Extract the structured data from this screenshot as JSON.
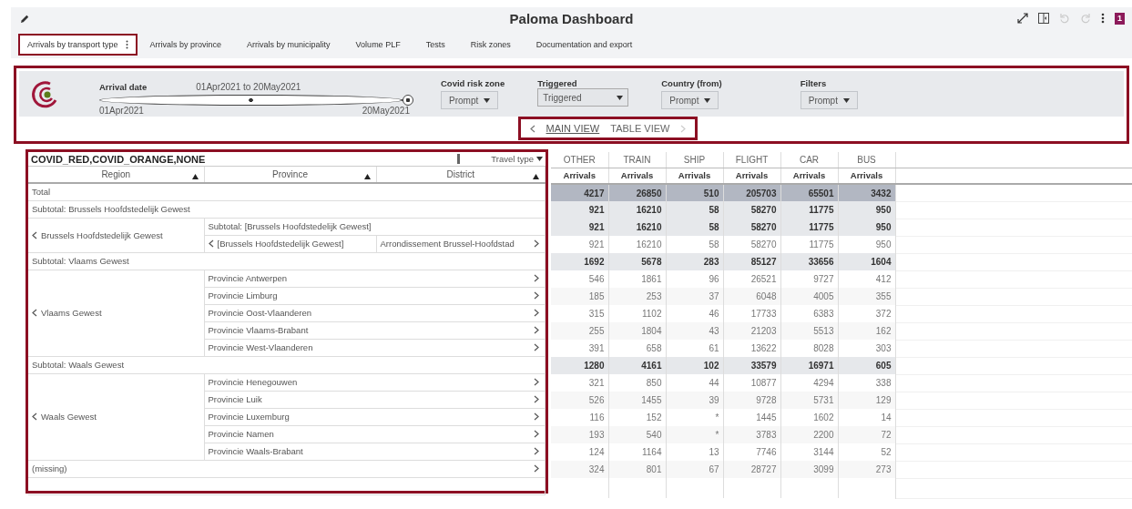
{
  "header": {
    "title": "Paloma Dashboard",
    "badge": "1",
    "undo_disabled": true,
    "redo_disabled": true
  },
  "tabs": [
    {
      "label": "Arrivals by transport type",
      "selected": true
    },
    {
      "label": "Arrivals by province",
      "selected": false
    },
    {
      "label": "Arrivals by municipality",
      "selected": false
    },
    {
      "label": "Volume PLF",
      "selected": false
    },
    {
      "label": "Tests",
      "selected": false
    },
    {
      "label": "Risk zones",
      "selected": false
    },
    {
      "label": "Documentation and export",
      "selected": false
    }
  ],
  "filters": {
    "arrival_date": {
      "label": "Arrival date",
      "range": "01Apr2021 to 20May2021",
      "start": "01Apr2021",
      "end": "20May2021",
      "level": 1
    },
    "dropdowns": [
      {
        "label": "Covid risk zone",
        "value": "Prompt",
        "kind": "button"
      },
      {
        "label": "Triggered",
        "value": "Triggered",
        "kind": "select"
      },
      {
        "label": "Country (from)",
        "value": "Prompt",
        "kind": "button"
      },
      {
        "label": "Filters",
        "value": "Prompt",
        "kind": "button"
      }
    ]
  },
  "views": {
    "items": [
      {
        "label": "MAIN VIEW",
        "selected": true
      },
      {
        "label": "TABLE VIEW",
        "selected": false
      }
    ],
    "prev_disabled": false,
    "next_disabled": true
  },
  "crosstab": {
    "title": "COVID_RED,COVID_ORANGE,NONE",
    "column_dropdown": "Travel type",
    "row_headers": [
      "Region",
      "Province",
      "District"
    ],
    "columns": [
      {
        "name": "OTHER",
        "measure": "Arrivals"
      },
      {
        "name": "TRAIN",
        "measure": "Arrivals"
      },
      {
        "name": "SHIP",
        "measure": "Arrivals"
      },
      {
        "name": "FLIGHT",
        "measure": "Arrivals"
      },
      {
        "name": "CAR",
        "measure": "Arrivals"
      },
      {
        "name": "BUS",
        "measure": "Arrivals"
      }
    ],
    "rows": [
      {
        "kind": "total",
        "label": "Total",
        "values": [
          "4217",
          "26850",
          "510",
          "205703",
          "65501",
          "3432"
        ]
      },
      {
        "kind": "subtotal",
        "label": "Subtotal: Brussels Hoofdstedelijk Gewest",
        "values": [
          "921",
          "16210",
          "58",
          "58270",
          "11775",
          "950"
        ]
      },
      {
        "kind": "group",
        "region": "Brussels Hoofdstedelijk Gewest",
        "children": [
          {
            "kind": "subtotal",
            "label": "Subtotal: [Brussels Hoofdstedelijk Gewest]",
            "values": [
              "921",
              "16210",
              "58",
              "58270",
              "11775",
              "950"
            ]
          },
          {
            "kind": "detail",
            "province": "[Brussels Hoofdstedelijk Gewest]",
            "district": "Arrondissement Brussel-Hoofdstad",
            "values": [
              "921",
              "16210",
              "58",
              "58270",
              "11775",
              "950"
            ]
          }
        ]
      },
      {
        "kind": "subtotal",
        "label": "Subtotal: Vlaams Gewest",
        "values": [
          "1692",
          "5678",
          "283",
          "85127",
          "33656",
          "1604"
        ]
      },
      {
        "kind": "group",
        "region": "Vlaams Gewest",
        "children": [
          {
            "kind": "province",
            "label": "Provincie Antwerpen",
            "values": [
              "546",
              "1861",
              "96",
              "26521",
              "9727",
              "412"
            ]
          },
          {
            "kind": "province",
            "label": "Provincie Limburg",
            "values": [
              "185",
              "253",
              "37",
              "6048",
              "4005",
              "355"
            ]
          },
          {
            "kind": "province",
            "label": "Provincie Oost-Vlaanderen",
            "values": [
              "315",
              "1102",
              "46",
              "17733",
              "6383",
              "372"
            ]
          },
          {
            "kind": "province",
            "label": "Provincie Vlaams-Brabant",
            "values": [
              "255",
              "1804",
              "43",
              "21203",
              "5513",
              "162"
            ]
          },
          {
            "kind": "province",
            "label": "Provincie West-Vlaanderen",
            "values": [
              "391",
              "658",
              "61",
              "13622",
              "8028",
              "303"
            ]
          }
        ]
      },
      {
        "kind": "subtotal",
        "label": "Subtotal: Waals Gewest",
        "values": [
          "1280",
          "4161",
          "102",
          "33579",
          "16971",
          "605"
        ]
      },
      {
        "kind": "group",
        "region": "Waals Gewest",
        "children": [
          {
            "kind": "province",
            "label": "Provincie Henegouwen",
            "values": [
              "321",
              "850",
              "44",
              "10877",
              "4294",
              "338"
            ]
          },
          {
            "kind": "province",
            "label": "Provincie Luik",
            "values": [
              "526",
              "1455",
              "39",
              "9728",
              "5731",
              "129"
            ]
          },
          {
            "kind": "province",
            "label": "Provincie Luxemburg",
            "values": [
              "116",
              "152",
              "*",
              "1445",
              "1602",
              "14"
            ]
          },
          {
            "kind": "province",
            "label": "Provincie Namen",
            "values": [
              "193",
              "540",
              "*",
              "3783",
              "2200",
              "72"
            ]
          },
          {
            "kind": "province",
            "label": "Provincie Waals-Brabant",
            "values": [
              "124",
              "1164",
              "13",
              "7746",
              "3144",
              "52"
            ]
          }
        ]
      },
      {
        "kind": "missing",
        "label": "(missing)",
        "values": [
          "324",
          "801",
          "67",
          "28727",
          "3099",
          "273"
        ]
      }
    ]
  }
}
